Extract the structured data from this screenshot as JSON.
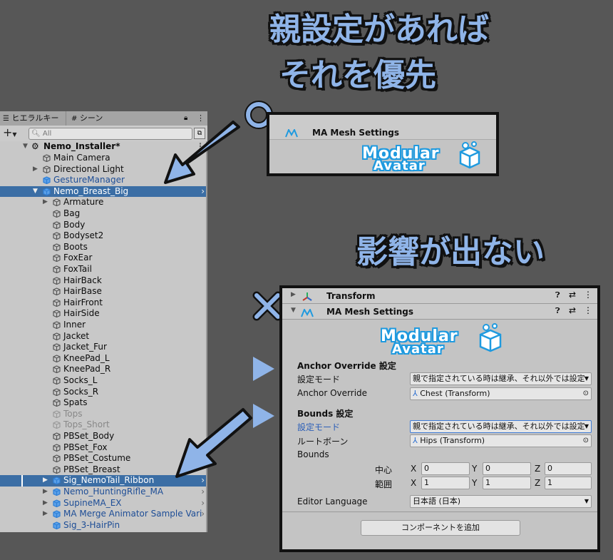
{
  "headline_top": {
    "line1": "親設定があれば",
    "line2": "それを優先"
  },
  "headline_mid": "影響が出ない",
  "markers": {
    "circle": "○",
    "cross": "×"
  },
  "hierarchy": {
    "tab_label": "ヒエラルキー",
    "tab2_label": "シーン",
    "add_label": "+",
    "search_placeholder": "All",
    "root": "Nemo_Installer*",
    "rows": [
      {
        "label": "Main Camera"
      },
      {
        "label": "Directional Light"
      },
      {
        "label": "GestureManager"
      },
      {
        "label": "Nemo_Breast_Big"
      },
      {
        "label": "Armature"
      },
      {
        "label": "Bag"
      },
      {
        "label": "Body"
      },
      {
        "label": "Bodyset2"
      },
      {
        "label": "Boots"
      },
      {
        "label": "FoxEar"
      },
      {
        "label": "FoxTail"
      },
      {
        "label": "HairBack"
      },
      {
        "label": "HairBase"
      },
      {
        "label": "HairFront"
      },
      {
        "label": "HairSide"
      },
      {
        "label": "Inner"
      },
      {
        "label": "Jacket"
      },
      {
        "label": "Jacket_Fur"
      },
      {
        "label": "KneePad_L"
      },
      {
        "label": "KneePad_R"
      },
      {
        "label": "Socks_L"
      },
      {
        "label": "Socks_R"
      },
      {
        "label": "Spats"
      },
      {
        "label": "Tops"
      },
      {
        "label": "Tops_Short"
      },
      {
        "label": "PBSet_Body"
      },
      {
        "label": "PBSet_Fox"
      },
      {
        "label": "PBSet_Costume"
      },
      {
        "label": "PBSet_Breast"
      },
      {
        "label": "Sig_NemoTail_Ribbon"
      },
      {
        "label": "Nemo_HuntingRifle_MA"
      },
      {
        "label": "SupineMA_EX"
      },
      {
        "label": "MA Merge Animator Sample Vari"
      },
      {
        "label": "Sig_3-HairPin"
      }
    ]
  },
  "small_panel": {
    "title": "MA Mesh Settings",
    "logo_line1": "Modular",
    "logo_line2": "Avatar"
  },
  "inspector": {
    "transform_title": "Transform",
    "mesh_title": "MA Mesh Settings",
    "logo_line1": "Modular",
    "logo_line2": "Avatar",
    "anchor_section": "Anchor Override 設定",
    "mode_label": "設定モード",
    "mode_value": "親で指定されている時は継承、それ以外では設定",
    "anchor_label": "Anchor Override",
    "anchor_value": "Chest (Transform)",
    "bounds_section": "Bounds 設定",
    "bounds_mode_label": "設定モード",
    "bounds_mode_value": "親で指定されている時は継承、それ以外では設定",
    "root_bone_label": "ルートボーン",
    "root_bone_value": "Hips (Transform)",
    "bounds_label": "Bounds",
    "center_label": "中心",
    "extent_label": "範囲",
    "x": "X",
    "y": "Y",
    "z": "Z",
    "center": [
      "0",
      "0",
      "0"
    ],
    "extent": [
      "1",
      "1",
      "1"
    ],
    "lang_label": "Editor Language",
    "lang_value": "日本語 (日本)",
    "add_component": "コンポーネントを追加"
  },
  "colors": {
    "accent": "#8fb4e8",
    "selection": "#3b6ea5",
    "logo": "#1f9adf"
  }
}
